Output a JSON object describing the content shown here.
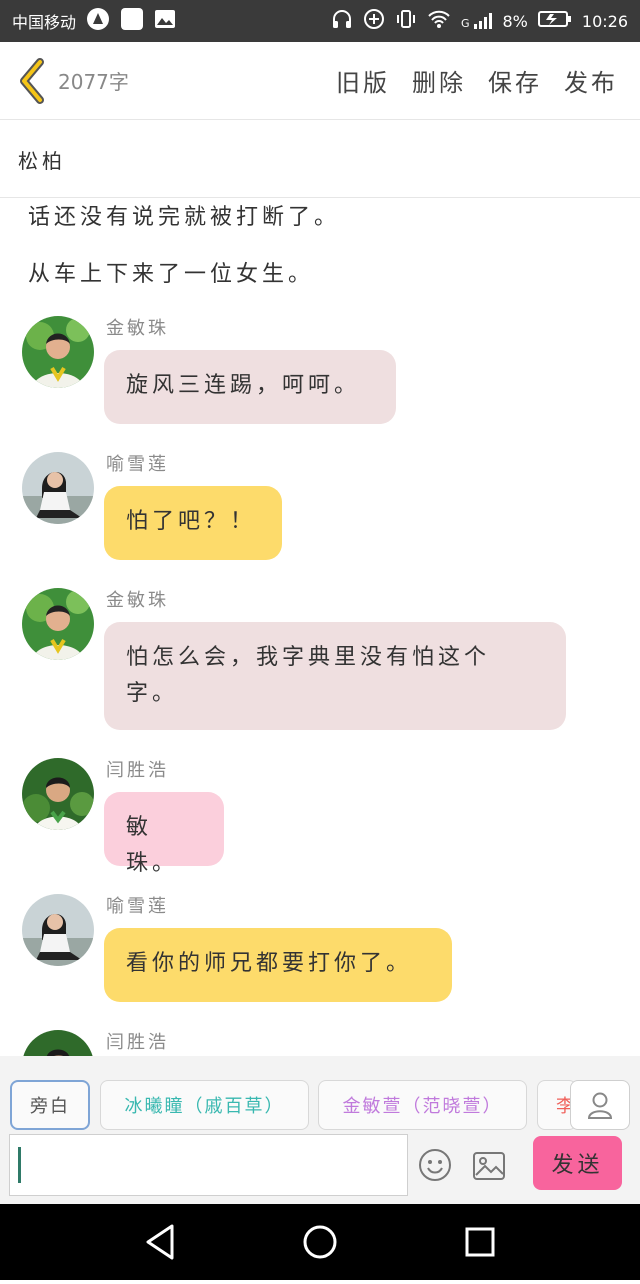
{
  "status": {
    "carrier": "中国移动",
    "signal": "G",
    "battery": "8%",
    "time": "10:26"
  },
  "header": {
    "word_count": "2077字",
    "actions": [
      "旧版",
      "删除",
      "保存",
      "发布"
    ]
  },
  "story": {
    "title": "松柏",
    "narration": [
      "话还没有说完就被打断了。",
      "从车上下来了一位女生。"
    ]
  },
  "messages": [
    {
      "name": "金敏珠",
      "lines": [
        "旋风三连踢，呵呵。"
      ],
      "style": "jin"
    },
    {
      "name": "喻雪莲",
      "lines": [
        "怕了吧？！"
      ],
      "style": "yu"
    },
    {
      "name": "金敏珠",
      "lines": [
        "怕怎么会，我字典里没有怕这个",
        "字。"
      ],
      "style": "jin"
    },
    {
      "name": "闫胜浩",
      "lines": [
        "敏珠。"
      ],
      "style": "yan"
    },
    {
      "name": "喻雪莲",
      "lines": [
        "看你的师兄都要打你了。"
      ],
      "style": "yu"
    },
    {
      "name": "闫胜浩",
      "lines": [],
      "style": "yan"
    }
  ],
  "composer": {
    "tabs": [
      {
        "label": "旁白",
        "color": "#555555"
      },
      {
        "label": "冰曦瞳（戚百草）",
        "color": "#39b8b0"
      },
      {
        "label": "金敏萱（范晓萱）",
        "color": "#c07adc"
      },
      {
        "label": "李",
        "color": "#f0605a"
      }
    ],
    "input_value": "",
    "send_label": "发送"
  },
  "colors": {
    "bubble_jin": "#efdfe0",
    "bubble_yu": "#fddb6b",
    "bubble_yan": "#fbcfdc",
    "send_button": "#f8649d",
    "back_arrow": "#f5c518"
  }
}
